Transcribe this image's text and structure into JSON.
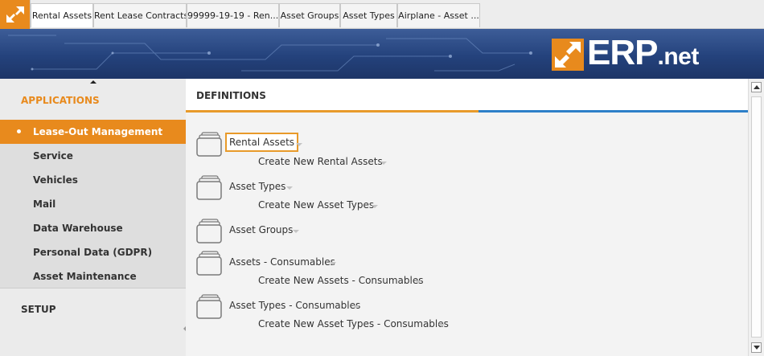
{
  "tabs": [
    {
      "label": "Rental Assets"
    },
    {
      "label": "Rent Lease Contracts"
    },
    {
      "label": "99999-19-19 - Ren..."
    },
    {
      "label": "Asset Groups"
    },
    {
      "label": "Asset Types"
    },
    {
      "label": "Airplane - Asset ..."
    }
  ],
  "brand": {
    "name": "ERP",
    "suffix": ".net",
    "logo_icon": "erp-arrows-logo",
    "accent_color": "#e88a1d",
    "banner_color": "#24427c"
  },
  "sidebar": {
    "applications_heading": "APPLICATIONS",
    "items": [
      {
        "label": "Lease-Out Management",
        "active": true
      },
      {
        "label": "Service"
      },
      {
        "label": "Vehicles"
      },
      {
        "label": "Mail"
      },
      {
        "label": "Data Warehouse"
      },
      {
        "label": "Personal Data (GDPR)"
      },
      {
        "label": "Asset Maintenance"
      }
    ],
    "setup_heading": "SETUP"
  },
  "main": {
    "title": "DEFINITIONS",
    "entries": [
      {
        "label": "Rental Assets",
        "create_label": "Create New Rental Assets",
        "highlighted": true
      },
      {
        "label": "Asset Types",
        "create_label": "Create New Asset Types"
      },
      {
        "label": "Asset Groups"
      },
      {
        "label": "Assets - Consumables",
        "create_label": "Create New Assets - Consumables"
      },
      {
        "label": "Asset Types - Consumables",
        "create_label": "Create New Asset Types - Consumables"
      }
    ],
    "icon": "folder-stack-icon"
  }
}
